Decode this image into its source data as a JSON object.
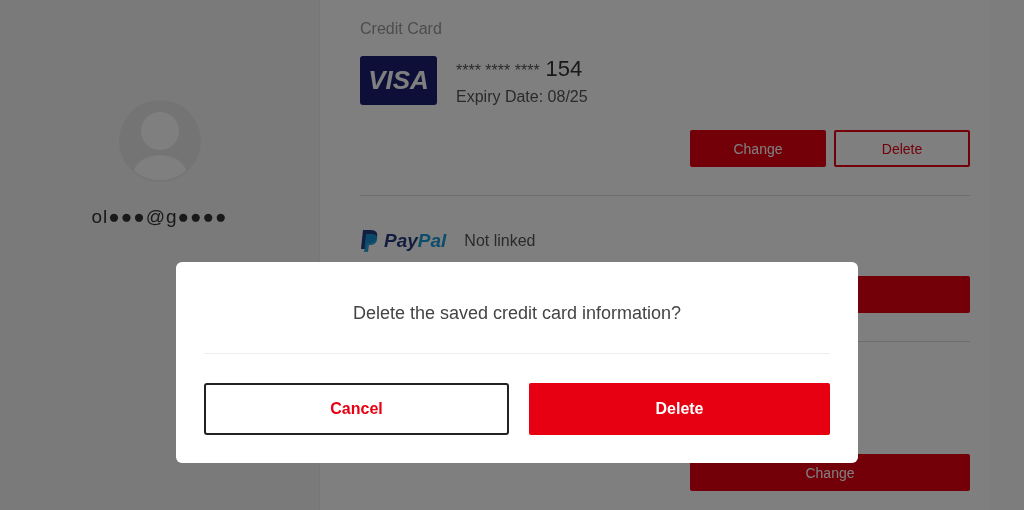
{
  "profile": {
    "email": "ol●●●@g●●●●"
  },
  "credit_card": {
    "title": "Credit Card",
    "brand": "VISA",
    "number_mask": "**** **** ****",
    "number_last": "154",
    "expiry": "Expiry Date: 08/25",
    "buttons": [
      {
        "label": "Change",
        "kind": "filled"
      },
      {
        "label": "Delete",
        "kind": "outline"
      }
    ]
  },
  "paypal": {
    "wordmark": [
      "Pay",
      "Pal"
    ],
    "status": "Not linked"
  },
  "third_section": {
    "button": {
      "label": "Change",
      "kind": "filled"
    }
  },
  "dialog": {
    "message": "Delete the saved credit card information?",
    "buttons": [
      {
        "label": "Cancel",
        "kind": "outline"
      },
      {
        "label": "Delete",
        "kind": "primary"
      }
    ]
  }
}
